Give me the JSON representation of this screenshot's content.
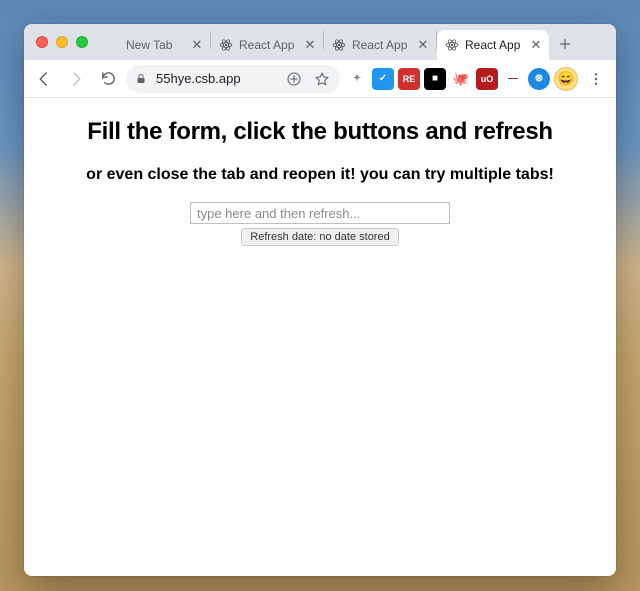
{
  "browser": {
    "tabs": [
      {
        "label": "New Tab",
        "favicon": "none",
        "active": false
      },
      {
        "label": "React App",
        "favicon": "react",
        "active": false
      },
      {
        "label": "React App",
        "favicon": "react",
        "active": false
      },
      {
        "label": "React App",
        "favicon": "react",
        "active": true
      }
    ],
    "url": "55hye.csb.app"
  },
  "extensions": [
    {
      "name": "ext-1",
      "bg": "#8a8a8a",
      "fg": "#fff",
      "text": "✦"
    },
    {
      "name": "ext-2",
      "bg": "#2196f3",
      "fg": "#fff",
      "text": "✓"
    },
    {
      "name": "ext-3",
      "bg": "#d32f2f",
      "fg": "#fff",
      "text": "RE"
    },
    {
      "name": "ext-4",
      "bg": "#000",
      "fg": "#fff",
      "text": "■"
    },
    {
      "name": "ext-5",
      "bg": "#555",
      "fg": "#fff",
      "text": "🐙"
    },
    {
      "name": "ext-6",
      "bg": "#b71c1c",
      "fg": "#fff",
      "text": "uO"
    },
    {
      "name": "ext-7",
      "bg": "#fff",
      "fg": "#8b2f2f",
      "text": "—"
    },
    {
      "name": "ext-8",
      "bg": "#1e88e5",
      "fg": "#fff",
      "text": "⊗"
    }
  ],
  "page": {
    "heading": "Fill the form, click the buttons and refresh",
    "subheading": "or even close the tab and reopen it! you can try multiple tabs!",
    "input_placeholder": "type here and then refresh...",
    "button_label": "Refresh date: no date stored"
  }
}
